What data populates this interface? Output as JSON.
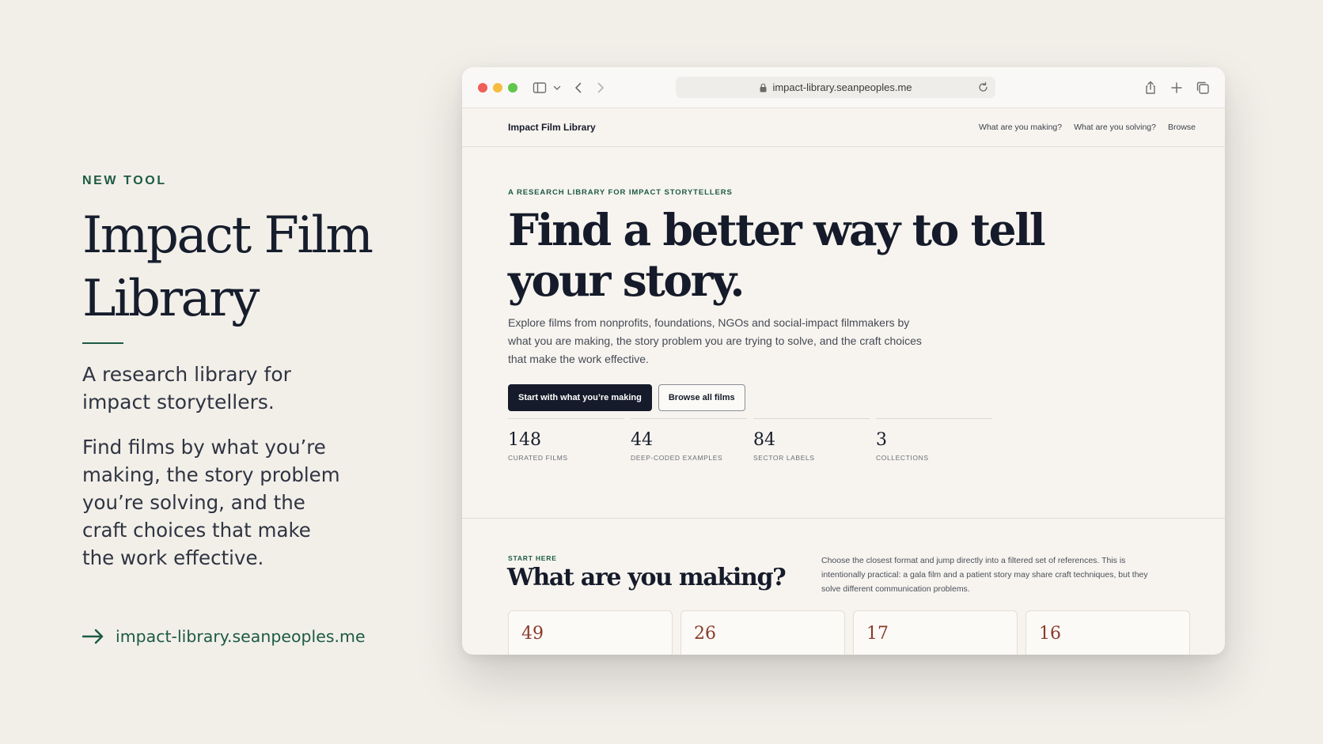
{
  "promo": {
    "eyebrow": "NEW TOOL",
    "title": "Impact Film Library",
    "subtitle": "A research library for impact storytellers.",
    "body": "Find films by what you’re making, the story problem you’re solving, and the craft choices that make the work effective.",
    "link": "impact-library.seanpeoples.me"
  },
  "browser": {
    "url": "impact-library.seanpeoples.me"
  },
  "site": {
    "brand": "Impact Film Library",
    "nav": [
      "What are you making?",
      "What are you solving?",
      "Browse"
    ],
    "hero": {
      "eyebrow": "A RESEARCH LIBRARY FOR IMPACT STORYTELLERS",
      "title": "Find a better way to tell your story.",
      "description": "Explore films from nonprofits, foundations, NGOs and social-impact filmmakers by what you are making, the story problem you are trying to solve, and the craft choices that make the work effective.",
      "primary_button": "Start with what you’re making",
      "secondary_button": "Browse all films"
    },
    "stats": [
      {
        "value": "148",
        "label": "CURATED FILMS"
      },
      {
        "value": "44",
        "label": "DEEP-CODED EXAMPLES"
      },
      {
        "value": "84",
        "label": "SECTOR LABELS"
      },
      {
        "value": "3",
        "label": "COLLECTIONS"
      }
    ],
    "section": {
      "eyebrow": "START HERE",
      "title": "What are you making?",
      "description": "Choose the closest format and jump directly into a filtered set of references. This is intentionally practical: a gala film and a patient story may share craft techniques, but they solve different communication problems."
    },
    "cards": [
      "49",
      "26",
      "17",
      "16"
    ]
  },
  "colors": {
    "accent_green": "#1d5a45",
    "ink": "#151b2a",
    "card_number": "#8a3a2a",
    "page_bg": "#f2efe9"
  }
}
